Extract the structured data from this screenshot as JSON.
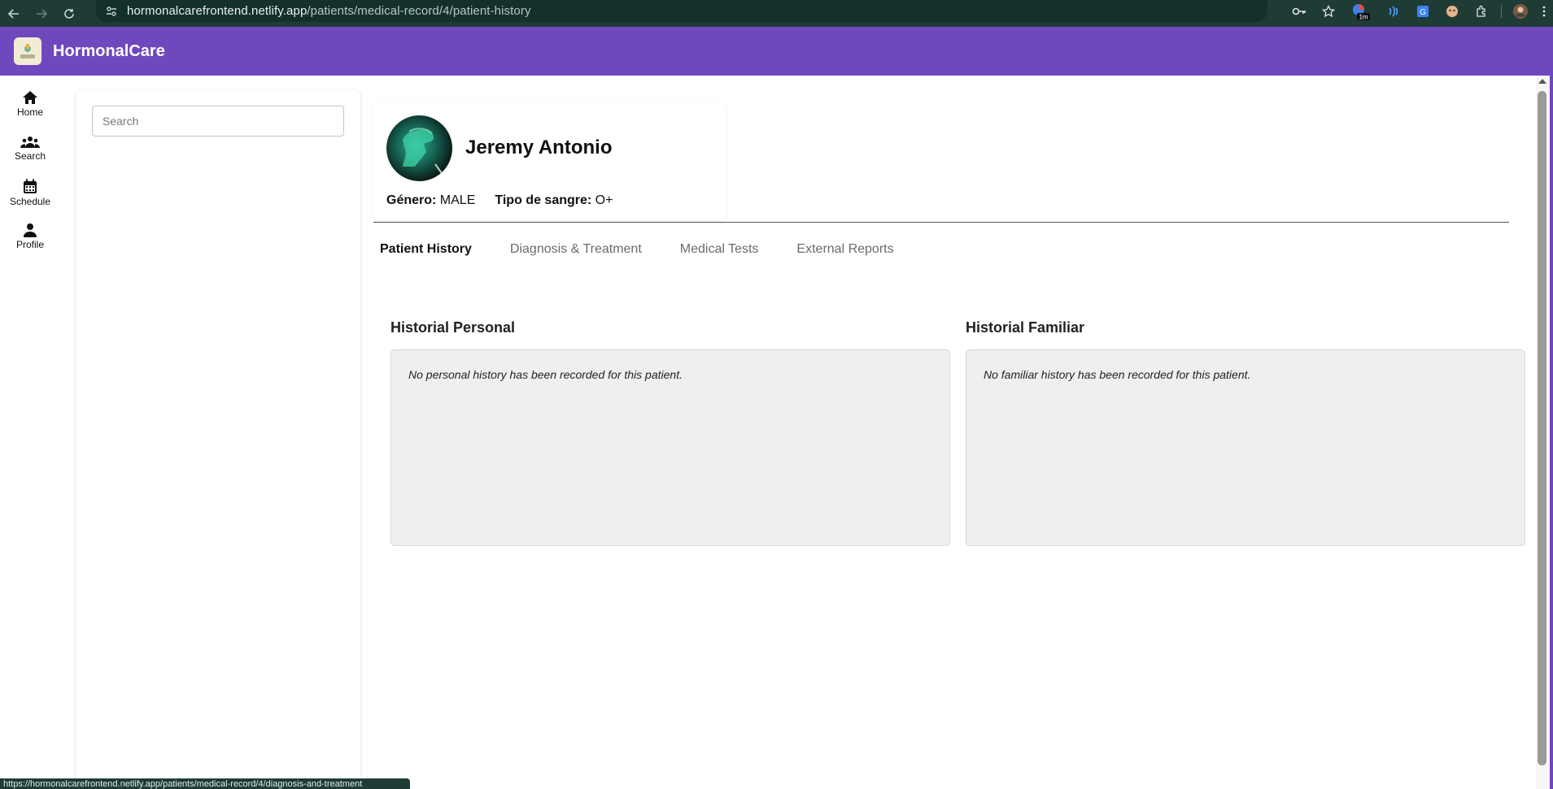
{
  "browser": {
    "url_host": "hormonalcarefrontend.netlify.app",
    "url_path": "/patients/medical-record/4/patient-history",
    "extension_badge": "1m"
  },
  "app": {
    "title": "HormonalCare"
  },
  "rail": {
    "items": [
      {
        "label": "Home",
        "icon": "home-icon"
      },
      {
        "label": "Search",
        "icon": "group-icon"
      },
      {
        "label": "Schedule",
        "icon": "calendar-icon"
      },
      {
        "label": "Profile",
        "icon": "person-icon"
      }
    ]
  },
  "search": {
    "placeholder": "Search"
  },
  "patient": {
    "name": "Jeremy Antonio",
    "gender_label": "Género:",
    "gender_value": "MALE",
    "blood_label": "Tipo de sangre:",
    "blood_value": "O+"
  },
  "tabs": [
    {
      "label": "Patient History",
      "active": true
    },
    {
      "label": "Diagnosis & Treatment",
      "active": false
    },
    {
      "label": "Medical Tests",
      "active": false
    },
    {
      "label": "External Reports",
      "active": false
    }
  ],
  "personal_history": {
    "title": "Historial Personal",
    "empty_text": "No personal history has been recorded for this patient."
  },
  "family_history": {
    "title": "Historial Familiar",
    "empty_text": "No familiar history has been recorded for this patient."
  },
  "status_link": "https://hormonalcarefrontend.netlify.app/patients/medical-record/4/diagnosis-and-treatment",
  "colors": {
    "header": "#6f48bd",
    "browser": "#1e3b36"
  }
}
